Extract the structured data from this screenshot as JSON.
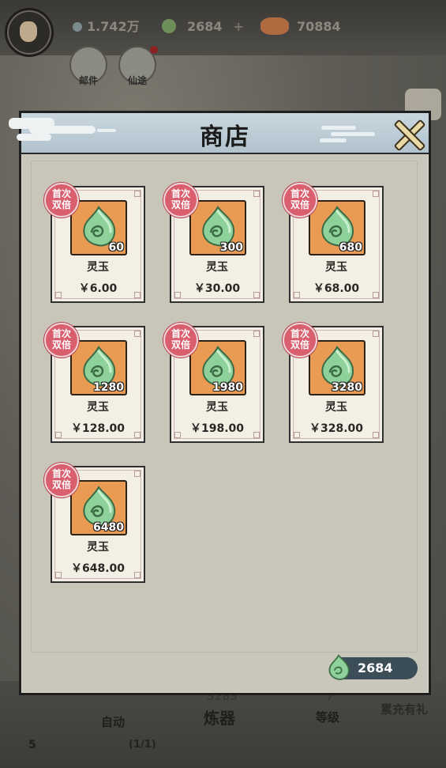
{
  "top_bar": {
    "silver": "1.742万",
    "jade": "2684",
    "jade_plus": "+",
    "power": "70884"
  },
  "top_buttons": [
    {
      "label": "邮件"
    },
    {
      "label": "仙途"
    }
  ],
  "bottom_bar": {
    "auto": "自动",
    "lianqi_num": "3283",
    "lianqi": "炼器",
    "level_num": "7",
    "level": "等级",
    "leichong": "累充有礼",
    "count": "(1/1)",
    "left_num": "5"
  },
  "shop": {
    "title": "商店",
    "balance": "2684",
    "items": [
      {
        "badge_line1": "首次",
        "badge_line2": "双倍",
        "qty": "60",
        "name": "灵玉",
        "price": "￥6.00"
      },
      {
        "badge_line1": "首次",
        "badge_line2": "双倍",
        "qty": "300",
        "name": "灵玉",
        "price": "￥30.00"
      },
      {
        "badge_line1": "首次",
        "badge_line2": "双倍",
        "qty": "680",
        "name": "灵玉",
        "price": "￥68.00"
      },
      {
        "badge_line1": "首次",
        "badge_line2": "双倍",
        "qty": "1280",
        "name": "灵玉",
        "price": "￥128.00"
      },
      {
        "badge_line1": "首次",
        "badge_line2": "双倍",
        "qty": "1980",
        "name": "灵玉",
        "price": "￥198.00"
      },
      {
        "badge_line1": "首次",
        "badge_line2": "双倍",
        "qty": "3280",
        "name": "灵玉",
        "price": "￥328.00"
      },
      {
        "badge_line1": "首次",
        "badge_line2": "双倍",
        "qty": "6480",
        "name": "灵玉",
        "price": "￥648.00"
      }
    ]
  },
  "colors": {
    "card_icon_bg": "#e99b54",
    "badge": "#d95f6f",
    "jade_green": "#7cc48a",
    "header_blue": "#b8c8d2"
  },
  "icons": {
    "gem": "jade-leaf-icon",
    "close": "close-icon"
  }
}
